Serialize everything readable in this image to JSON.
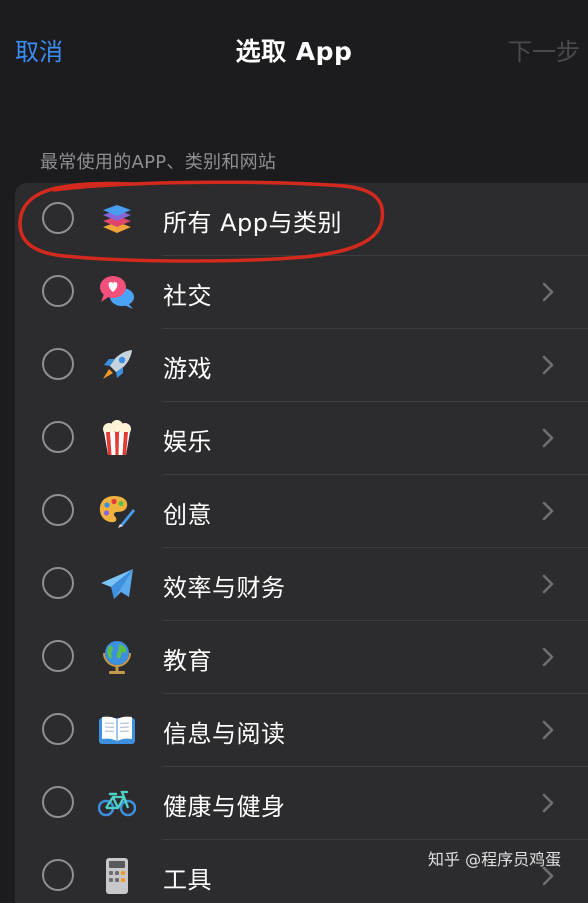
{
  "nav": {
    "cancel_label": "取消",
    "title": "选取 App",
    "next_label": "下一步"
  },
  "section_header": "最常使用的APP、类别和网站",
  "accent_color": "#3b8cf5",
  "annotation_color": "#d42a1e",
  "items": [
    {
      "label": "所有 App与类别",
      "icon": "stack-icon",
      "chevron": false,
      "selected": false
    },
    {
      "label": "社交",
      "icon": "chat-heart-icon",
      "chevron": true,
      "selected": false
    },
    {
      "label": "游戏",
      "icon": "rocket-icon",
      "chevron": true,
      "selected": false
    },
    {
      "label": "娱乐",
      "icon": "popcorn-icon",
      "chevron": true,
      "selected": false
    },
    {
      "label": "创意",
      "icon": "palette-icon",
      "chevron": true,
      "selected": false
    },
    {
      "label": "效率与财务",
      "icon": "paper-plane-icon",
      "chevron": true,
      "selected": false
    },
    {
      "label": "教育",
      "icon": "globe-icon",
      "chevron": true,
      "selected": false
    },
    {
      "label": "信息与阅读",
      "icon": "book-icon",
      "chevron": true,
      "selected": false
    },
    {
      "label": "健康与健身",
      "icon": "bicycle-icon",
      "chevron": true,
      "selected": false
    },
    {
      "label": "工具",
      "icon": "calculator-icon",
      "chevron": true,
      "selected": false
    }
  ],
  "watermark": "知乎 @程序员鸡蛋"
}
